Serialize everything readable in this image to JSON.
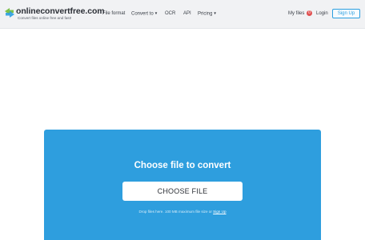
{
  "header": {
    "logo_name": "onlineconvertfree.com",
    "logo_tagline": "Convert files online free and fast!",
    "logo_icon": "convert-arrows-icon",
    "nav": {
      "file_format": "File format",
      "convert_to": "Convert to",
      "ocr": "OCR",
      "api": "API",
      "pricing": "Pricing",
      "dropdown_icon": "chevron-down-icon"
    },
    "my_files_label": "My files",
    "my_files_count": "0",
    "login_label": "Login",
    "signup_label": "Sign Up"
  },
  "upload": {
    "title": "Choose file to convert",
    "button_label": "CHOOSE FILE",
    "note_text": "Drop files here. 100 MB maximum file size or",
    "note_link": "Sign Up"
  },
  "colors": {
    "panel": "#2e9ede",
    "accent": "#2b9fe0",
    "badge": "#e05151"
  }
}
